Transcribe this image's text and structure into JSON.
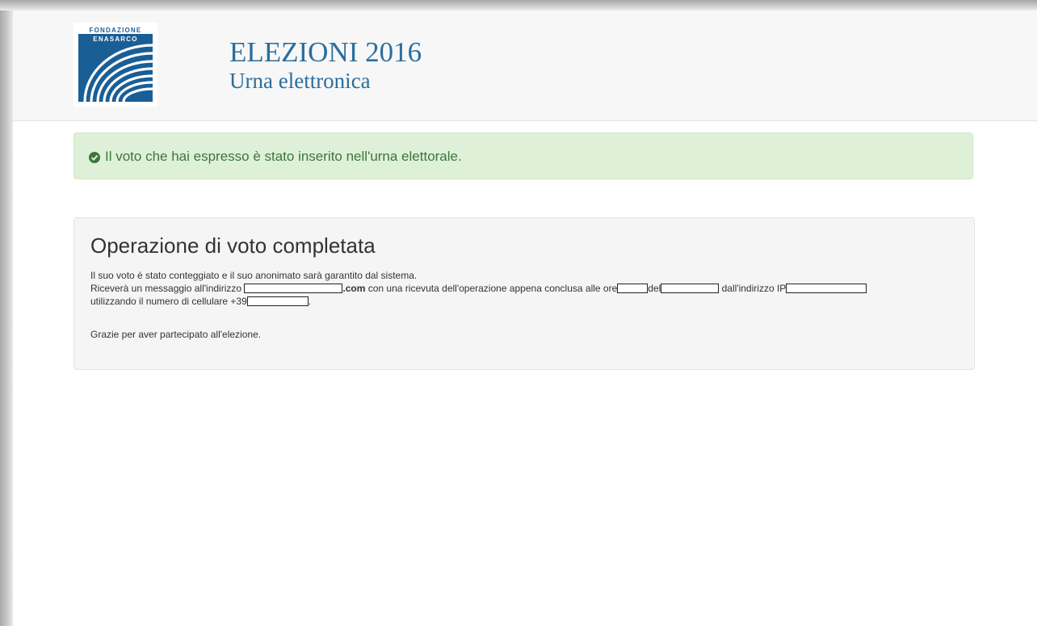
{
  "header": {
    "logo_text_top": "FONDAZIONE",
    "logo_text_bottom": "ENASARCO",
    "title": "ELEZIONI 2016",
    "subtitle": "Urna elettronica"
  },
  "alert": {
    "icon": "check-circle-icon",
    "message": "Il voto che hai espresso è stato inserito nell'urna elettorale."
  },
  "panel": {
    "title": "Operazione di voto completata",
    "line1": "Il suo voto è stato conteggiato e il suo anonimato sarà garantito dal sistema.",
    "line2_prefix": "Riceverà un messaggio all'indirizzo",
    "email_domain": ".com",
    "line2_mid": "con una ricevuta dell'operazione appena conclusa alle ore",
    "line2_del": "del",
    "line2_ip": "dall'indirizzo IP",
    "line3_prefix": "utilizzando il numero di cellulare +39",
    "line3_suffix": ".",
    "thanks": "Grazie per aver partecipato all'elezione."
  },
  "colors": {
    "brand_blue": "#2a6e9e",
    "logo_blue": "#1a5e96",
    "success_bg": "#dff0d8",
    "success_text": "#3c763d",
    "panel_bg": "#f5f5f5"
  }
}
